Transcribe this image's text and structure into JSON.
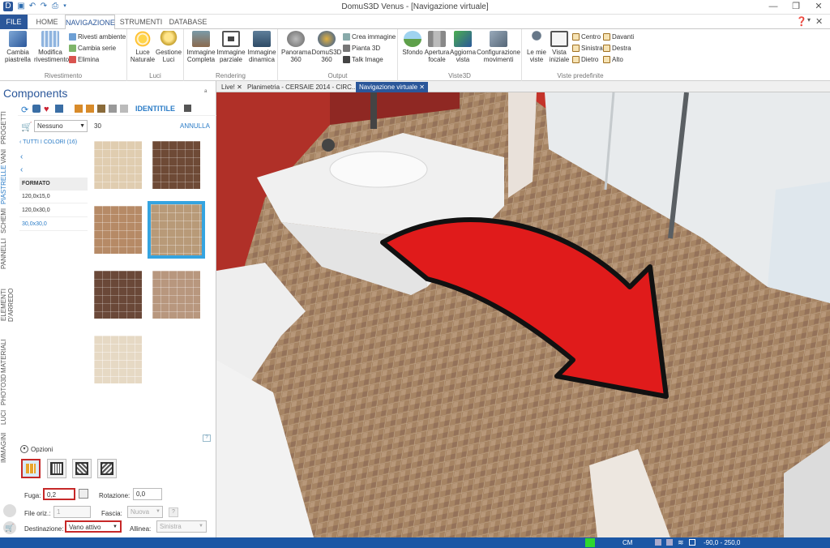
{
  "window": {
    "title": "DomuS3D Venus - [Navigazione virtuale]",
    "controls": [
      "—",
      "❐",
      "✕"
    ]
  },
  "ribbon_tabs": {
    "file": "FILE",
    "home": "HOME",
    "navigazione": "NAVIGAZIONE",
    "strumenti": "STRUMENTI",
    "database": "DATABASE"
  },
  "ribbon": {
    "rivestimento": {
      "label": "Rivestimento",
      "cambia_piastrella": "Cambia piastrella",
      "modifica_rivestimento": "Modifica rivestimento",
      "rivesti_ambiente": "Rivesti ambiente",
      "cambia_serie": "Cambia serie",
      "elimina": "Elimina"
    },
    "luci": {
      "label": "Luci",
      "luce_naturale": "Luce Naturale",
      "gestione_luci": "Gestione Luci"
    },
    "rendering": {
      "label": "Rendering",
      "immagine_completa": "Immagine Completa",
      "immagine_parziale": "Immagine parziale",
      "immagine_dinamica": "Immagine dinamica"
    },
    "output": {
      "label": "Output",
      "panorama": "Panorama 360",
      "domus3d360": "DomuS3D 360",
      "crea_immagine": "Crea immagine",
      "pianta_3d": "Pianta 3D",
      "talk_image": "Talk Image"
    },
    "vista3d": {
      "label": "Viste3D",
      "sfondo": "Sfondo",
      "apertura_focale": "Apertura focale",
      "aggiorna_vista": "Aggiorna vista",
      "configurazione_movimenti": "Configurazione movimenti"
    },
    "viste_predefinite": {
      "label": "Viste predefinite",
      "le_mie_viste": "Le mie viste",
      "vista_iniziale": "Vista iniziale",
      "centro": "Centro",
      "sinistra": "Sinistra",
      "dietro": "Dietro",
      "davanti": "Davanti",
      "destra": "Destra",
      "alto": "Alto"
    }
  },
  "panel": {
    "title": "Components",
    "pin": "ᵃ",
    "brand": "IDENTITILE",
    "vertical_tabs": [
      "PROGETTI",
      "VANI",
      "PIASTRELLE",
      "SCHEMI",
      "PANNELLI",
      "ELEMENTI D'ARREDO",
      "MATERIALI",
      "PHOTO3D",
      "LUCI",
      "IMMAGINI"
    ],
    "filter_select": "Nessuno",
    "filter_value": "30",
    "annulla": "ANNULLA",
    "tutti_colori": "TUTTI I COLORI (16)",
    "formato_header": "FORMATO",
    "formats": [
      "120,0x15,0",
      "120,0x30,0",
      "30,0x30,0"
    ],
    "tile_colors": [
      "#e0cdb0",
      "#6e4a36",
      "#b68a66",
      "#b89a78",
      "#6a4838",
      "#b8977e",
      "#e6d9c4"
    ],
    "opzioni": "Opzioni",
    "fuga_label": "Fuga:",
    "fuga_value": "0,2",
    "rotazione_label": "Rotazione:",
    "rotazione_value": "0,0",
    "file_oriz_label": "File oriz.:",
    "file_oriz_value": "1",
    "fascia_label": "Fascia:",
    "fascia_value": "Nuova",
    "destinazione_label": "Destinazione:",
    "destinazione_value": "Vano attivo",
    "allinea_label": "Allinea:",
    "allinea_value": "Sinistra"
  },
  "doc_tabs": [
    "Live!",
    "Planimetria - CERSAIE 2014 - CIRC...",
    "Navigazione virtuale"
  ],
  "status": {
    "unit": "CM",
    "coords": "-90,0 - 250,0"
  }
}
